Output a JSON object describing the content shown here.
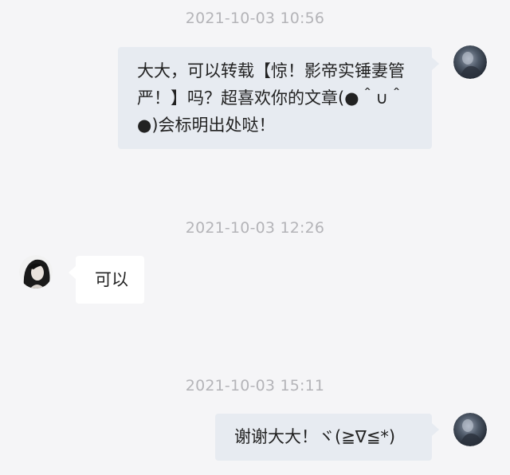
{
  "conversation": {
    "messages": [
      {
        "timestamp": "2021-10-03 10:56",
        "sender": "self",
        "text": "大大，可以转载【惊！影帝实锤妻管严！】吗？超喜欢你的文章(●＾∪＾●)会标明出处哒！"
      },
      {
        "timestamp": "2021-10-03 12:26",
        "sender": "other",
        "text": "可以"
      },
      {
        "timestamp": "2021-10-03 15:11",
        "sender": "self",
        "text": "谢谢大大！ヾ(≧∇≦*)"
      }
    ]
  },
  "colors": {
    "background": "#f5f5f7",
    "outgoing_bubble": "#e7ebf1",
    "incoming_bubble": "#ffffff",
    "timestamp_text": "#b4b4b8",
    "message_text": "#222222"
  }
}
